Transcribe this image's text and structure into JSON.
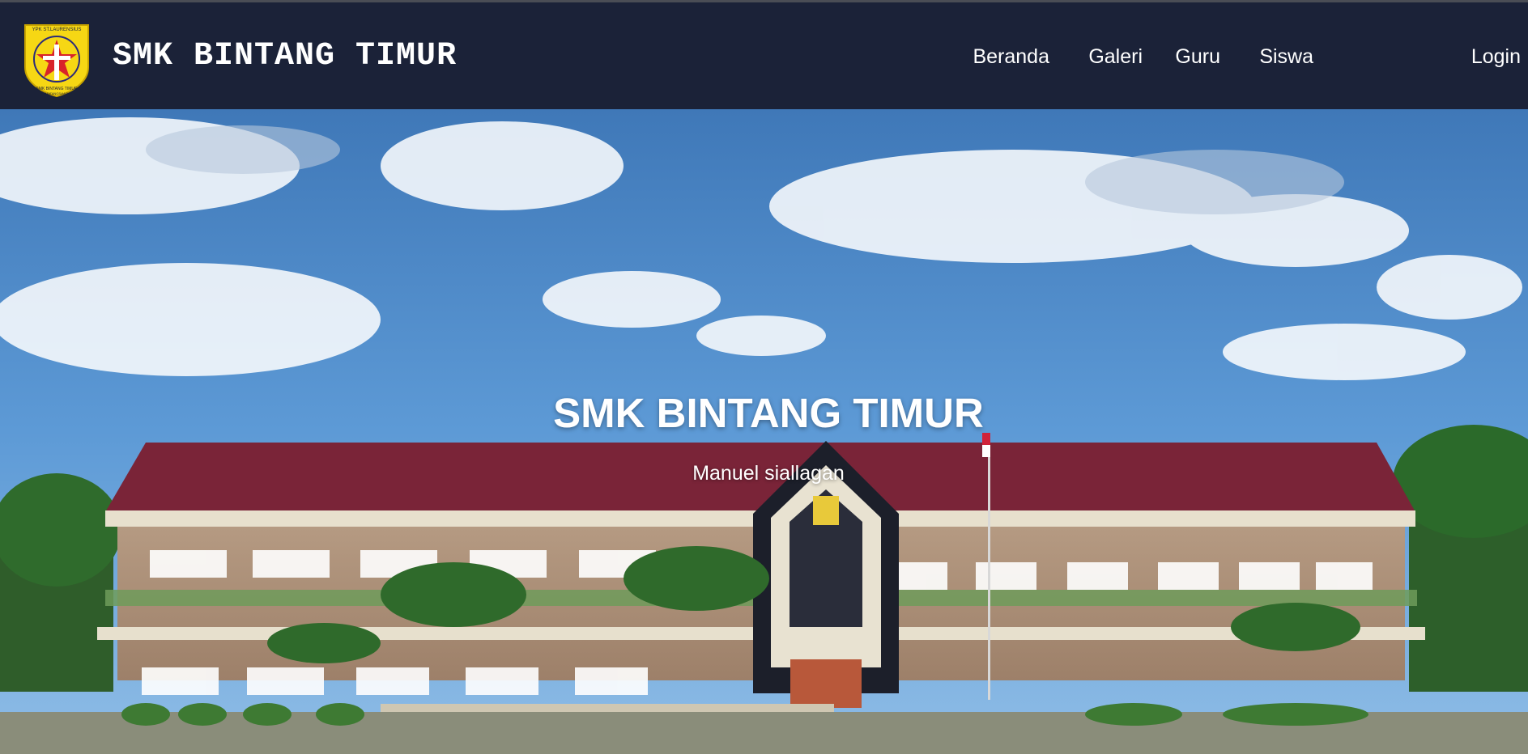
{
  "header": {
    "brand": "SMK BINTANG TIMUR",
    "logo_icon": "school-crest-icon",
    "logo_text": {
      "top": "YPK ST.LAURENSIUS",
      "bottom": "SMK BINTANG TIMUR",
      "city": "PEMATANGSIANTAR"
    }
  },
  "nav": {
    "items": [
      {
        "label": "Beranda"
      },
      {
        "label": "Galeri"
      },
      {
        "label": "Guru"
      },
      {
        "label": "Siswa"
      },
      {
        "label": "Login"
      }
    ]
  },
  "hero": {
    "title": "SMK BINTANG TIMUR",
    "subtitle": "Manuel siallagan",
    "image_icon": "school-building-photo"
  },
  "colors": {
    "navbar_bg": "#1b2238",
    "text": "#ffffff",
    "sky": "#4f8fd0",
    "roof": "#7a2438",
    "logo_yellow": "#f6d714"
  }
}
